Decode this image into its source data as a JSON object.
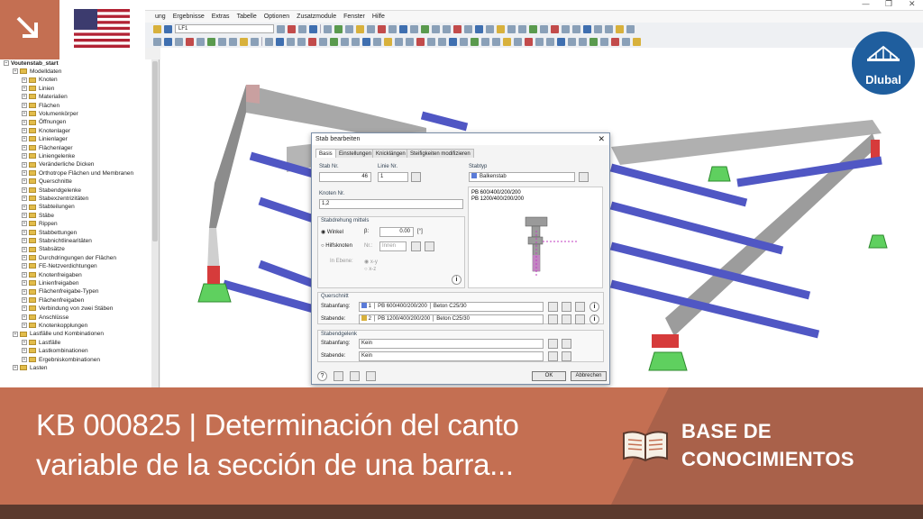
{
  "menu": [
    "ung",
    "Ergebnisse",
    "Extras",
    "Tabelle",
    "Optionen",
    "Zusatzmodule",
    "Fenster",
    "Hilfe"
  ],
  "toolbar": {
    "load_case": "LF1"
  },
  "tree": {
    "root": "Voutenstab_start",
    "items": [
      "Modelldaten",
      "Knoten",
      "Linien",
      "Materialien",
      "Flächen",
      "Volumenkörper",
      "Öffnungen",
      "Knotenlager",
      "Linienlager",
      "Flächenlager",
      "Liniengelenke",
      "Veränderliche Dicken",
      "Orthotrope Flächen und Membranen",
      "Querschnitte",
      "Stabendgelenke",
      "Stabexzentrizitäten",
      "Stabteilungen",
      "Stäbe",
      "Rippen",
      "Stabbettungen",
      "Stabnichtlinearitäten",
      "Stabsätze",
      "Durchdringungen der Flächen",
      "FE-Netzverdichtungen",
      "Knotenfreigaben",
      "Linienfreigaben",
      "Flächenfreigabe-Typen",
      "Flächenfreigaben",
      "Verbindung von zwei Stäben",
      "Anschlüsse",
      "Knotenkopplungen",
      "Lastfälle und Kombinationen",
      "Lastfälle",
      "Lastkombinationen",
      "Ergebniskombinationen",
      "Lasten"
    ]
  },
  "dialog": {
    "title": "Stab bearbeiten",
    "tabs": [
      "Basis",
      "Einstellungen",
      "Knicklängen",
      "Steifigkeiten modifizieren"
    ],
    "stab_nr_label": "Stab Nr.",
    "stab_nr": "46",
    "linie_label": "Linie Nr.",
    "linie": "1",
    "stabtyp_label": "Stabtyp",
    "stabtyp": "Balkenstab",
    "knoten_label": "Knoten Nr.",
    "knoten": "1,2",
    "drehung_label": "Stabdrehung mittels",
    "winkel": "Winkel",
    "beta": "β:",
    "beta_val": "0.00",
    "beta_unit": "[°]",
    "hilfsknoten": "Hilfsknoten",
    "nr": "Nr.:",
    "innen": "Innen",
    "ebene": "In Ebene:",
    "xy": "x-y",
    "xz": "x-z",
    "preview_lines": [
      "PB 600/400/200/200",
      "PB 1200/400/200/200"
    ],
    "qs_label": "Querschnitt",
    "stabanfang": "Stabanfang:",
    "stabende": "Stabende:",
    "qs_anfang_nr": "1",
    "qs_anfang": "PB 600/400/200/200",
    "qs_anfang_mat": "Beton C25/30",
    "qs_ende_nr": "2",
    "qs_ende": "PB 1200/400/200/200",
    "qs_ende_mat": "Beton C25/30",
    "gelenk_label": "Stabendgelenk",
    "kein": "Kein",
    "ok": "OK",
    "cancel": "Abbrechen"
  },
  "logo": "Dlubal",
  "banner": {
    "title_line1": "KB 000825 | Determinación del canto",
    "title_line2": "variable de la sección de una barra...",
    "category_line1": "BASE DE",
    "category_line2": "CONOCIMIENTOS"
  },
  "colors": {
    "brand_orange": "#c46f52",
    "dlubal_blue": "#1f5e9e"
  }
}
